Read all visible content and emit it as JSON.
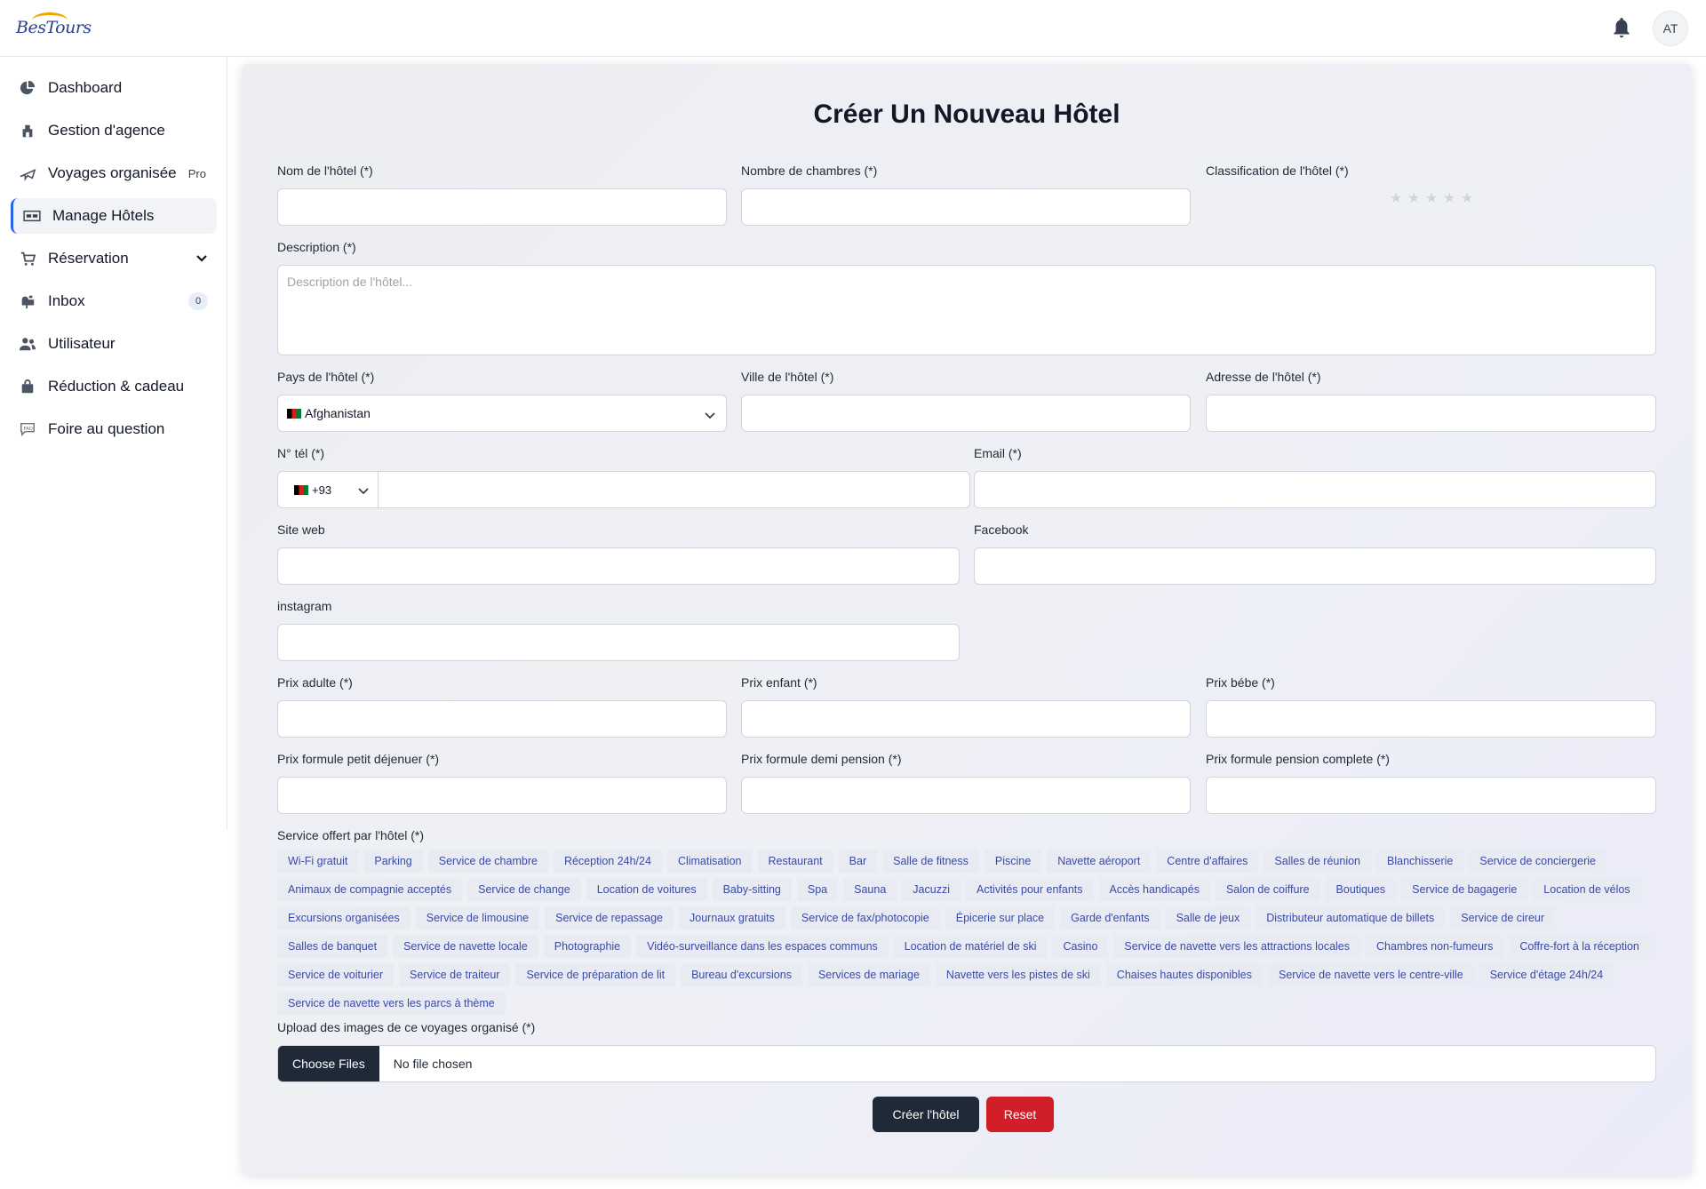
{
  "app": {
    "logo_text": "BesTours",
    "user_initials": "AT"
  },
  "sidebar": {
    "items": [
      {
        "label": "Dashboard",
        "icon": "pie-chart-icon"
      },
      {
        "label": "Gestion d'agence",
        "icon": "building-icon"
      },
      {
        "label": "Voyages organisée",
        "icon": "plane-icon",
        "badge": "Pro"
      },
      {
        "label": "Manage Hôtels",
        "icon": "hotel-icon",
        "active": true
      },
      {
        "label": "Réservation",
        "icon": "cart-icon"
      },
      {
        "label": "Inbox",
        "icon": "mailbox-icon",
        "count": "0"
      },
      {
        "label": "Utilisateur",
        "icon": "users-icon"
      },
      {
        "label": "Réduction & cadeau",
        "icon": "gift-bag-icon"
      },
      {
        "label": "Foire au question",
        "icon": "faq-icon"
      }
    ]
  },
  "form": {
    "title": "Créer Un Nouveau Hôtel",
    "labels": {
      "name": "Nom de l'hôtel (*)",
      "rooms": "Nombre de chambres (*)",
      "classification": "Classification de l'hôtel (*)",
      "description": "Description (*)",
      "country": "Pays de l'hôtel (*)",
      "city": "Ville de l'hôtel (*)",
      "address": "Adresse de l'hôtel (*)",
      "phone": "N° tél (*)",
      "email": "Email (*)",
      "website": "Site web",
      "facebook": "Facebook",
      "instagram": "instagram",
      "price_adult": "Prix adulte (*)",
      "price_child": "Prix enfant (*)",
      "price_baby": "Prix bébe (*)",
      "price_breakfast": "Prix formule petit déjenuer (*)",
      "price_half": "Prix formule demi pension (*)",
      "price_full": "Prix formule pension complete (*)",
      "services": "Service offert par l'hôtel (*)",
      "upload": "Upload des images de ce voyages organisé (*)"
    },
    "description_placeholder": "Description de l'hôtel...",
    "country_value": "Afghanistan",
    "phone_code": "+93",
    "rating": 0,
    "rating_max": 5,
    "services": [
      "Wi-Fi gratuit",
      "Parking",
      "Service de chambre",
      "Réception 24h/24",
      "Climatisation",
      "Restaurant",
      "Bar",
      "Salle de fitness",
      "Piscine",
      "Navette aéroport",
      "Centre d'affaires",
      "Salles de réunion",
      "Blanchisserie",
      "Service de conciergerie",
      "Animaux de compagnie acceptés",
      "Service de change",
      "Location de voitures",
      "Baby-sitting",
      "Spa",
      "Sauna",
      "Jacuzzi",
      "Activités pour enfants",
      "Accès handicapés",
      "Salon de coiffure",
      "Boutiques",
      "Service de bagagerie",
      "Location de vélos",
      "Excursions organisées",
      "Service de limousine",
      "Service de repassage",
      "Journaux gratuits",
      "Service de fax/photocopie",
      "Épicerie sur place",
      "Garde d'enfants",
      "Salle de jeux",
      "Distributeur automatique de billets",
      "Service de cireur",
      "Salles de banquet",
      "Service de navette locale",
      "Photographie",
      "Vidéo-surveillance dans les espaces communs",
      "Location de matériel de ski",
      "Casino",
      "Service de navette vers les attractions locales",
      "Chambres non-fumeurs",
      "Coffre-fort à la réception",
      "Service de voiturier",
      "Service de traiteur",
      "Service de préparation de lit",
      "Bureau d'excursions",
      "Services de mariage",
      "Navette vers les pistes de ski",
      "Chaises hautes disponibles",
      "Service de navette vers le centre-ville",
      "Service d'étage 24h/24",
      "Service de navette vers les parcs à thème"
    ],
    "file_button": "Choose Files",
    "file_status": "No file chosen",
    "submit_label": "Créer l'hôtel",
    "reset_label": "Reset"
  }
}
